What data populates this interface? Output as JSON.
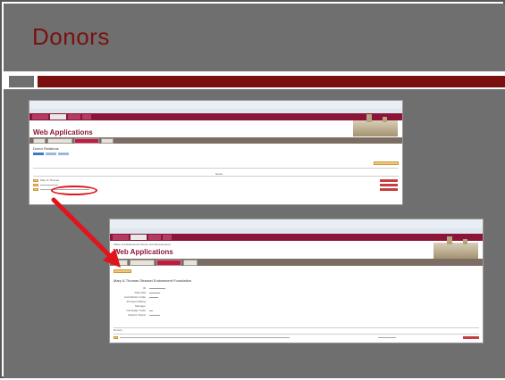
{
  "slide": {
    "title": "Donors"
  },
  "shot1": {
    "app_title": "Web Applications",
    "section_title": "Donor Relations",
    "tabs": [
      "",
      "",
      "Donor Relations",
      ""
    ],
    "table_header": "Name",
    "row1_name": "Mary & Thomas"
  },
  "shot2": {
    "app_title": "Web Applications",
    "org_line": "Office of Advancement Donor and Development",
    "tabs": [
      "",
      "",
      "Donor Relations",
      ""
    ],
    "record_name": "Mary & Thomas Strassel Endowment Foundation",
    "section_label": "Donors",
    "fields": [
      {
        "label": "ID",
        "value": ""
      },
      {
        "label": "Date Add",
        "value": ""
      },
      {
        "label": "Contribution Code",
        "value": ""
      },
      {
        "label": "Prospect Rating",
        "value": ""
      },
      {
        "label": "Manager",
        "value": ""
      },
      {
        "label": "Campaign Code",
        "value": ""
      },
      {
        "label": "Solicitor Status",
        "value": ""
      }
    ]
  },
  "annotation": {
    "oval_color": "#e0141a",
    "arrow_color": "#e0141a"
  }
}
